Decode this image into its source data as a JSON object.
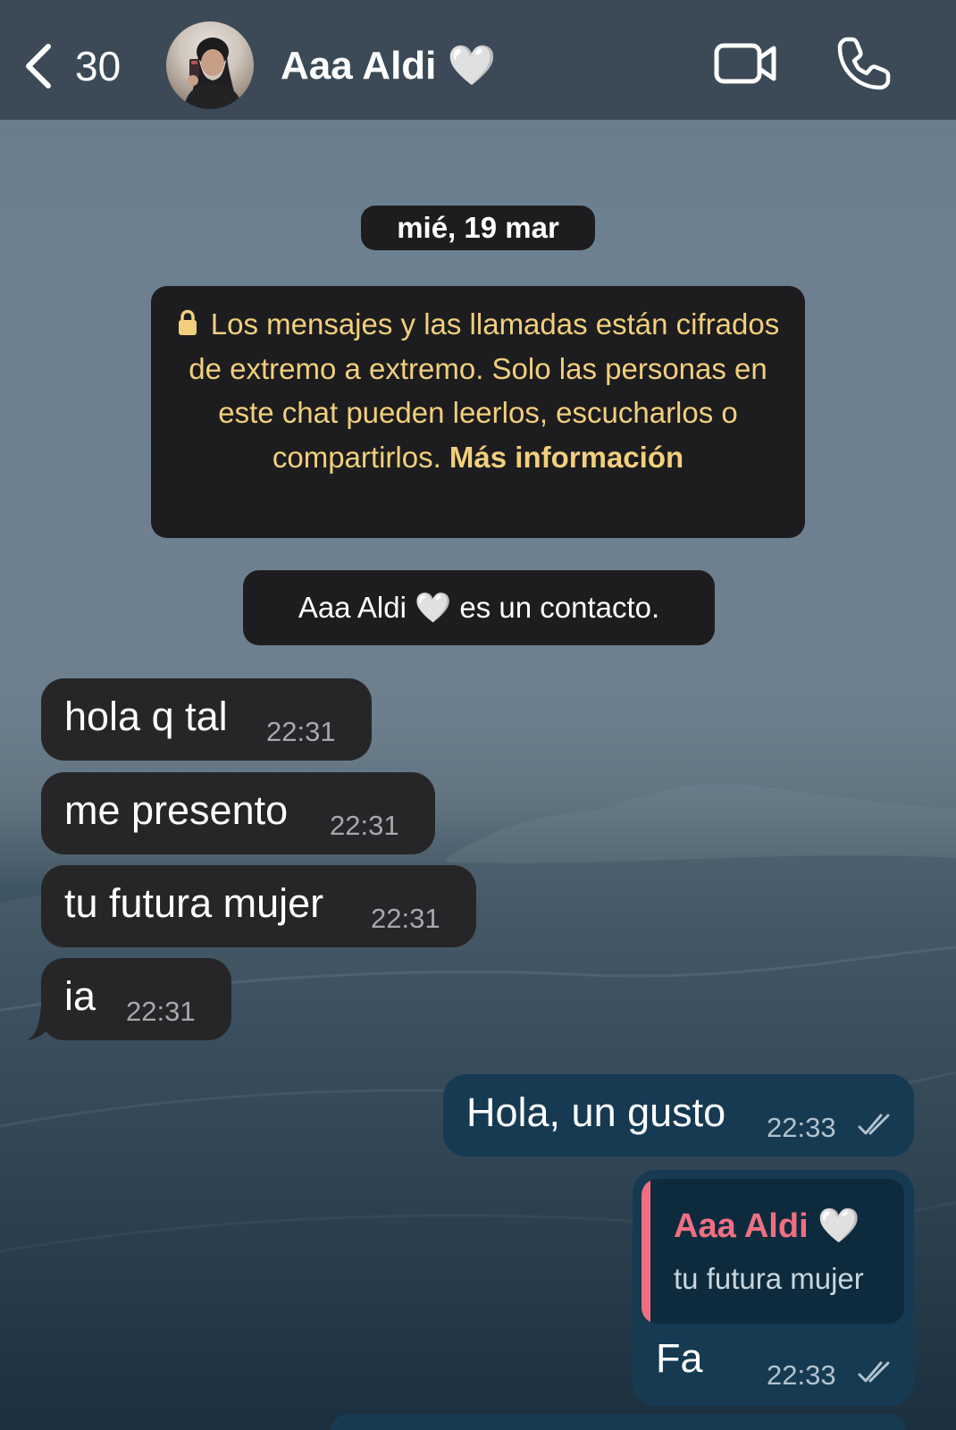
{
  "header": {
    "back_count": "30",
    "contact_name": "Aaa Aldi",
    "name_emoji": "🤍",
    "icons": [
      "chevron-left-icon",
      "video-call-icon",
      "phone-call-icon"
    ]
  },
  "chat": {
    "date_label": "mié, 19 mar",
    "encryption_notice": {
      "text": "Los mensajes y las llamadas están cifrados de extremo a extremo. Solo las personas en este chat pueden leerlos, escucharlos o compartirlos.",
      "link": "Más información",
      "icon": "lock-icon"
    },
    "contact_notice": {
      "name": "Aaa Aldi",
      "emoji": "🤍",
      "suffix": "es un contacto."
    },
    "messages": [
      {
        "direction": "in",
        "text": "hola q tal",
        "time": "22:31"
      },
      {
        "direction": "in",
        "text": "me presento",
        "time": "22:31"
      },
      {
        "direction": "in",
        "text": "tu futura mujer",
        "time": "22:31"
      },
      {
        "direction": "in",
        "text": "ia",
        "time": "22:31"
      },
      {
        "direction": "out",
        "text": "Hola, un gusto",
        "time": "22:33",
        "status": "read"
      },
      {
        "direction": "out",
        "text": "Fa",
        "time": "22:33",
        "status": "read",
        "reply_to": {
          "author": "Aaa Aldi",
          "author_emoji": "🤍",
          "text": "tu futura mujer"
        }
      }
    ]
  },
  "colors": {
    "header_bg": "#3b4a56",
    "incoming_bubble": "#262628",
    "outgoing_bubble": "#153a52",
    "notice_text": "#f2cf7c",
    "reply_accent": "#f16f82"
  }
}
